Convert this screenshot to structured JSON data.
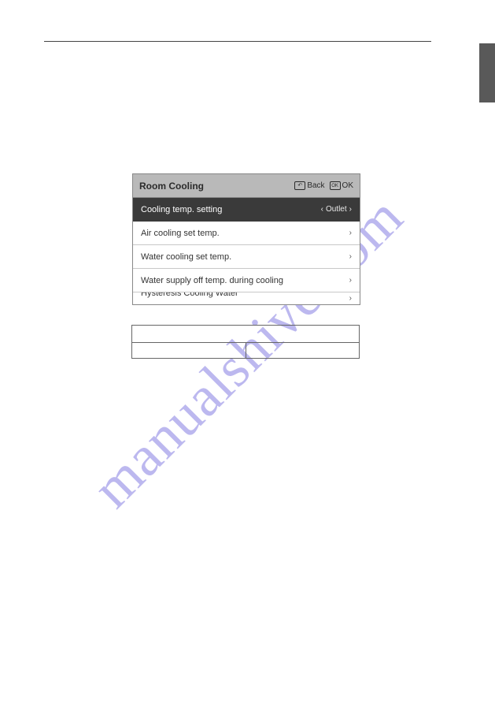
{
  "watermark": "manualshive.com",
  "screen": {
    "title": "Room Cooling",
    "back_label": "Back",
    "ok_label": "OK",
    "back_icon_glyph": "↶",
    "ok_icon_glyph": "OK",
    "rows": [
      {
        "label": "Cooling temp. setting",
        "value": "Outlet",
        "selected": true
      },
      {
        "label": "Air cooling set temp.",
        "value": "",
        "selected": false
      },
      {
        "label": "Water cooling set temp.",
        "value": "",
        "selected": false
      },
      {
        "label": "Water supply off temp. during cooling",
        "value": "",
        "selected": false
      }
    ],
    "partial_row_label": "Hysteresis Cooling Water"
  }
}
